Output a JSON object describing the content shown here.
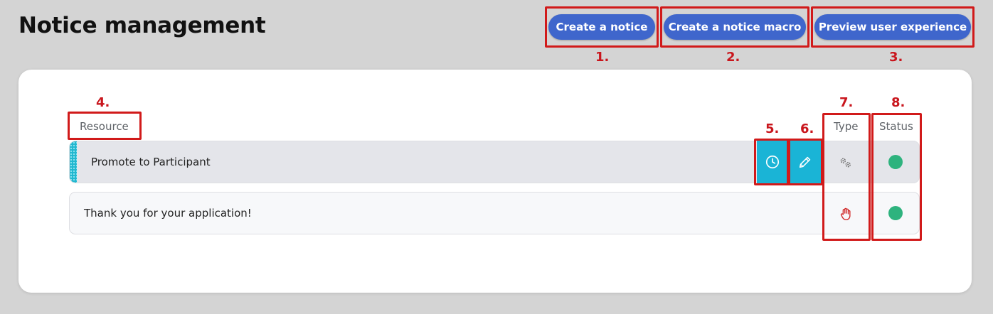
{
  "page": {
    "title": "Notice management"
  },
  "toolbar": {
    "create_notice_label": "Create a notice",
    "create_macro_label": "Create a notice macro",
    "preview_label": "Preview user experience"
  },
  "annotations": {
    "n1": "1.",
    "n2": "2.",
    "n3": "3.",
    "n4": "4.",
    "n5": "5.",
    "n6": "6.",
    "n7": "7.",
    "n8": "8."
  },
  "table": {
    "columns": {
      "resource": "Resource",
      "type": "Type",
      "status": "Status"
    },
    "rows": [
      {
        "label": "Promote to Participant",
        "type_icon": "gears-icon",
        "status": "active",
        "status_color": "#2eb37e",
        "actions": [
          "clock-icon",
          "pencil-icon"
        ]
      },
      {
        "label": "Thank you for your application!",
        "type_icon": "hand-icon",
        "status": "active",
        "status_color": "#2eb37e"
      }
    ]
  },
  "colors": {
    "background": "#d4d4d4",
    "primary_button": "#3f66cc",
    "action_button": "#1ab4d6",
    "annotation": "#d11a1a",
    "status_active": "#2eb37e",
    "manual_icon": "#d22b2b"
  }
}
